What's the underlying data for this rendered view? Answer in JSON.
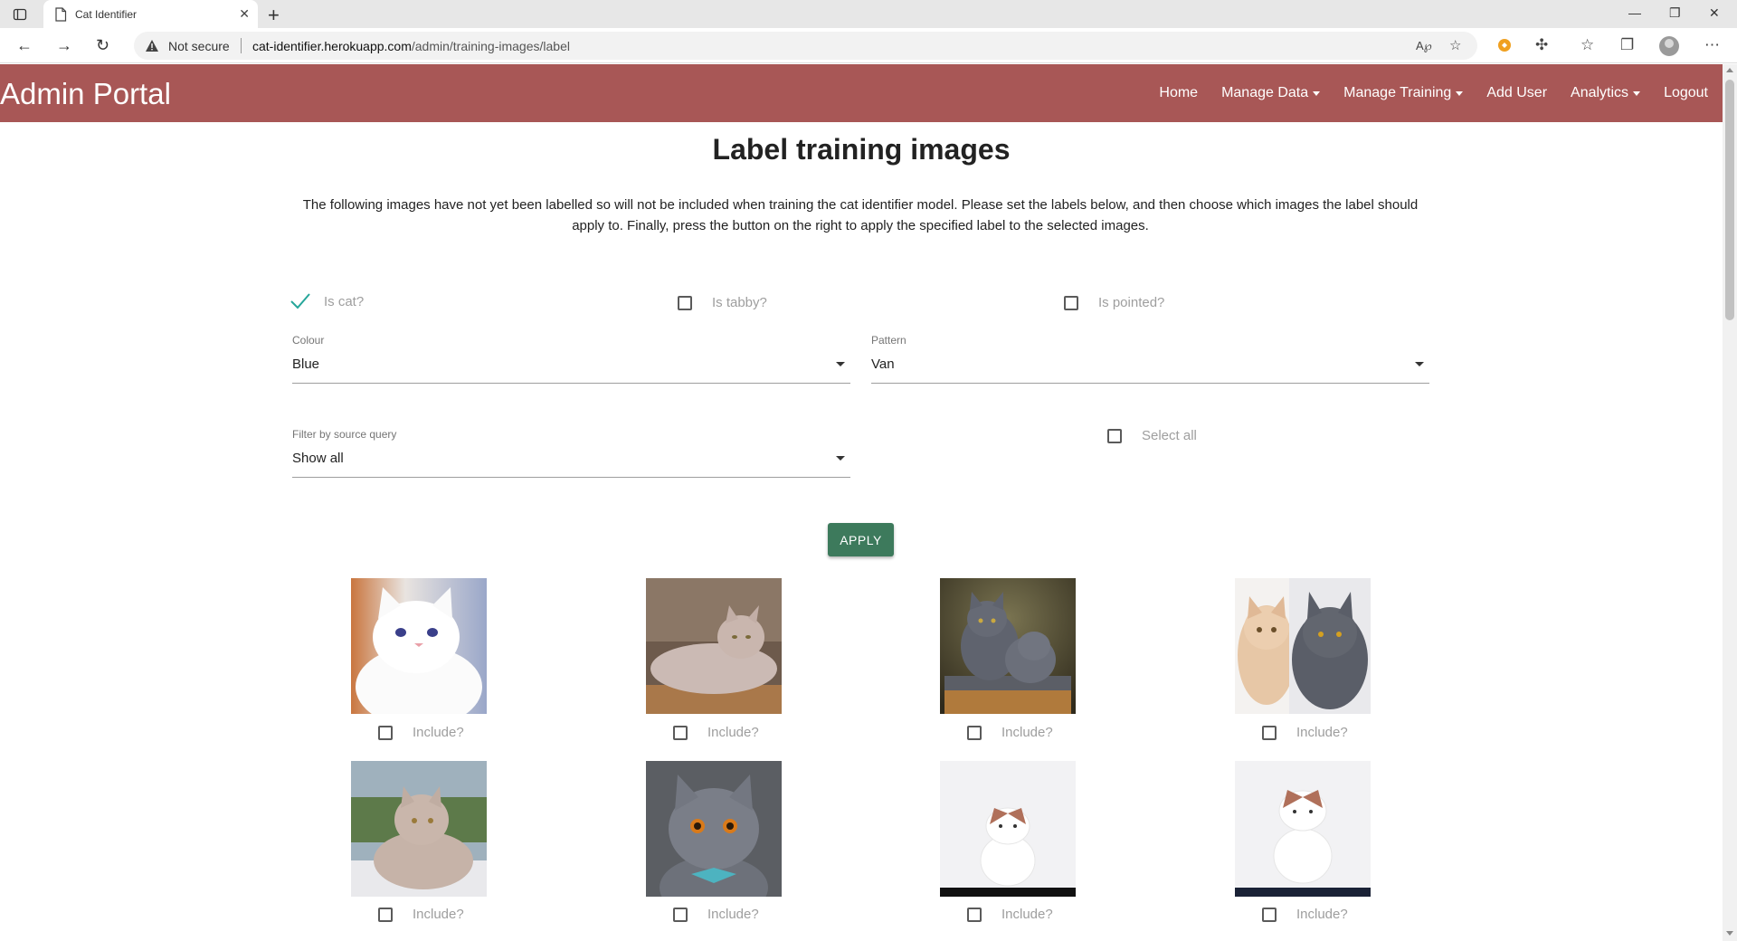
{
  "browser": {
    "tab_title": "Cat Identifier",
    "security_label": "Not secure",
    "url_domain": "cat-identifier.herokuapp.com",
    "url_path": "/admin/training-images/label"
  },
  "header": {
    "brand": "Admin Portal",
    "nav": {
      "home": "Home",
      "manage_data": "Manage Data",
      "manage_training": "Manage Training",
      "add_user": "Add User",
      "analytics": "Analytics",
      "logout": "Logout"
    },
    "color": "#a85756"
  },
  "page": {
    "title": "Label training images",
    "description": "The following images have not yet been labelled so will not be included when training the cat identifier model. Please set the labels below, and then choose which images the label should apply to. Finally, press the button on the right to apply the specified label to the selected images."
  },
  "labels": {
    "is_cat": {
      "label": "Is cat?",
      "checked": true
    },
    "is_tabby": {
      "label": "Is tabby?",
      "checked": false
    },
    "is_pointed": {
      "label": "Is pointed?",
      "checked": false
    },
    "colour": {
      "label": "Colour",
      "value": "Blue"
    },
    "pattern": {
      "label": "Pattern",
      "value": "Van"
    },
    "filter": {
      "label": "Filter by source query",
      "value": "Show all"
    },
    "select_all": {
      "label": "Select all",
      "checked": false
    }
  },
  "apply_label": "APPLY",
  "apply_color": "#3d7a5c",
  "images": [
    {
      "include_label": "Include?",
      "checked": false
    },
    {
      "include_label": "Include?",
      "checked": false
    },
    {
      "include_label": "Include?",
      "checked": false
    },
    {
      "include_label": "Include?",
      "checked": false
    },
    {
      "include_label": "Include?",
      "checked": false
    },
    {
      "include_label": "Include?",
      "checked": false
    },
    {
      "include_label": "Include?",
      "checked": false
    },
    {
      "include_label": "Include?",
      "checked": false
    }
  ]
}
